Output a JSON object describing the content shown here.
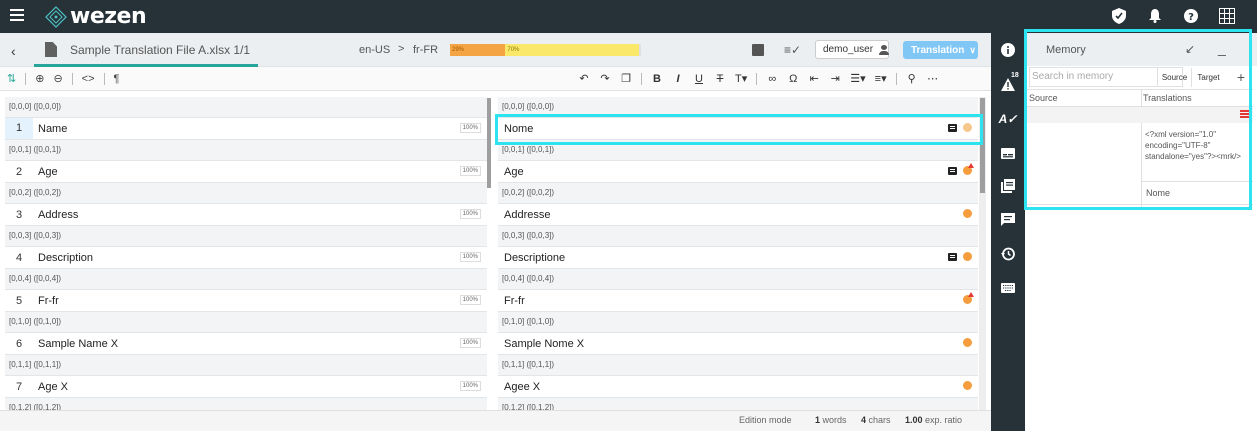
{
  "app": {
    "logo": "wezen"
  },
  "file": {
    "title": "Sample Translation File A.xlsx 1/1",
    "source_lang": "en-US",
    "arrow": ">",
    "target_lang": "fr-FR",
    "progress": [
      {
        "label": "29%",
        "value": 29,
        "color": "#f5a443"
      },
      {
        "label": "70%",
        "value": 70,
        "color": "#f9e86a"
      }
    ]
  },
  "header": {
    "user": "demo_user",
    "mode": "Translation"
  },
  "segments": [
    {
      "id": "[0,0,0] ([0,0,0])",
      "num": "1",
      "source": "Name",
      "score": "100%",
      "target": "Nome",
      "comment": true,
      "status": "light",
      "flag": false,
      "active": true
    },
    {
      "id": "[0,0,1] ([0,0,1])",
      "num": "2",
      "source": "Age",
      "score": "100%",
      "target": "Age",
      "comment": true,
      "status": "orange",
      "flag": true,
      "active": false
    },
    {
      "id": "[0,0,2] ([0,0,2])",
      "num": "3",
      "source": "Address",
      "score": "100%",
      "target": "Addresse",
      "comment": false,
      "status": "orange",
      "flag": false,
      "active": false
    },
    {
      "id": "[0,0,3] ([0,0,3])",
      "num": "4",
      "source": "Description",
      "score": "100%",
      "target": "Descriptione",
      "comment": true,
      "status": "orange",
      "flag": false,
      "active": false
    },
    {
      "id": "[0,0,4] ([0,0,4])",
      "num": "5",
      "source": "Fr-fr",
      "score": "100%",
      "target": "Fr-fr",
      "comment": false,
      "status": "orange",
      "flag": true,
      "active": false
    },
    {
      "id": "[0,1,0] ([0,1,0])",
      "num": "6",
      "source": "Sample Name X",
      "score": "100%",
      "target": "Sample Nome X",
      "comment": false,
      "status": "orange",
      "flag": false,
      "active": false
    },
    {
      "id": "[0,1,1] ([0,1,1])",
      "num": "7",
      "source": "Age X",
      "score": "100%",
      "target": "Agee X",
      "comment": false,
      "status": "orange",
      "flag": false,
      "active": false
    },
    {
      "id": "[0,1,2] ([0,1,2])",
      "num": "",
      "source": "",
      "score": "",
      "target": "",
      "comment": false,
      "status": "",
      "flag": false,
      "active": false
    }
  ],
  "status_bar": {
    "mode": "Edition mode",
    "words_num": "1",
    "words_label": "words",
    "chars_num": "4",
    "chars_label": "chars",
    "ratio_num": "1.00",
    "ratio_label": "exp. ratio"
  },
  "rail": {
    "badge": "18"
  },
  "memory": {
    "title": "Memory",
    "search_placeholder": "Search in memory",
    "opt_source": "Source",
    "opt_target": "Target",
    "add": "+",
    "col_source": "Source",
    "col_translations": "Translations",
    "xml": "<?xml version=\"1.0\" encoding=\"UTF-8\" standalone=\"yes\"?><mrk/>",
    "match": "Nome"
  }
}
